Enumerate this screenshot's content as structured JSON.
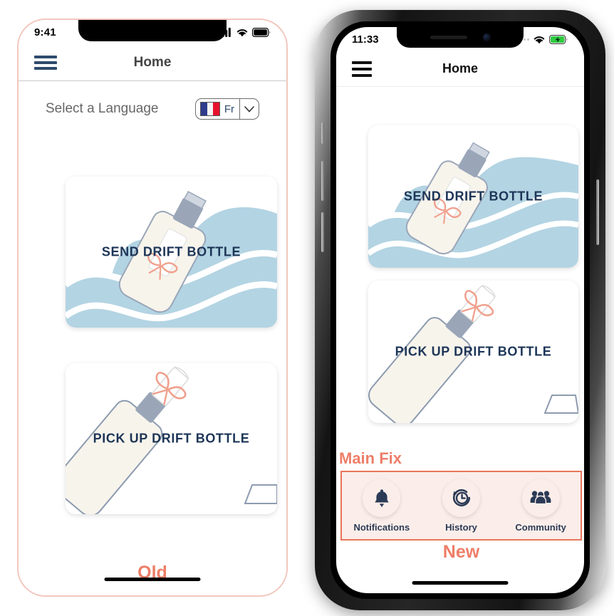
{
  "comparison": {
    "old_label": "Old",
    "new_label": "New",
    "annotation_label": "Main Fix",
    "accent_color": "#ee7e68",
    "highlight_border_color": "#e8755a",
    "highlight_fill_color": "#fbeeea"
  },
  "old_phone": {
    "status_bar": {
      "time": "9:41",
      "signal_icon": "cellular-signal-icon",
      "wifi_icon": "wifi-icon",
      "battery_icon": "battery-full-icon"
    },
    "header": {
      "menu_icon": "hamburger-menu-icon",
      "title": "Home"
    },
    "language_row": {
      "label": "Select a Language",
      "selected_code": "Fr",
      "flag_icon": "flag-france-icon",
      "caret_icon": "chevron-down-icon"
    },
    "cards": [
      {
        "label": "SEND DRIFT BOTTLE",
        "art": "waves-bottle-illustration"
      },
      {
        "label": "PICK UP DRIFT BOTTLE",
        "art": "bottle-scroll-illustration"
      }
    ]
  },
  "new_phone": {
    "status_bar": {
      "time": "11:33",
      "signal_icon": "cellular-dots-icon",
      "wifi_icon": "wifi-icon",
      "battery_icon": "battery-charging-icon",
      "battery_color": "#2ecc40"
    },
    "header": {
      "menu_icon": "hamburger-menu-icon",
      "title": "Home"
    },
    "cards": [
      {
        "label": "SEND DRIFT BOTTLE",
        "art": "waves-bottle-illustration"
      },
      {
        "label": "PICK UP DRIFT BOTTLE",
        "art": "bottle-scroll-illustration"
      }
    ],
    "bottom_nav": [
      {
        "label": "Notifications",
        "icon": "bell-icon"
      },
      {
        "label": "History",
        "icon": "history-clock-icon"
      },
      {
        "label": "Community",
        "icon": "people-group-icon"
      }
    ]
  },
  "theme": {
    "wave_color": "#b3d4e3",
    "bottle_fill": "#f7f4ec",
    "bottle_stroke": "#8d9bb0",
    "ribbon_color": "#f0a08d",
    "cap_color": "#9aa6b8",
    "card_label_color": "#1d3557"
  }
}
